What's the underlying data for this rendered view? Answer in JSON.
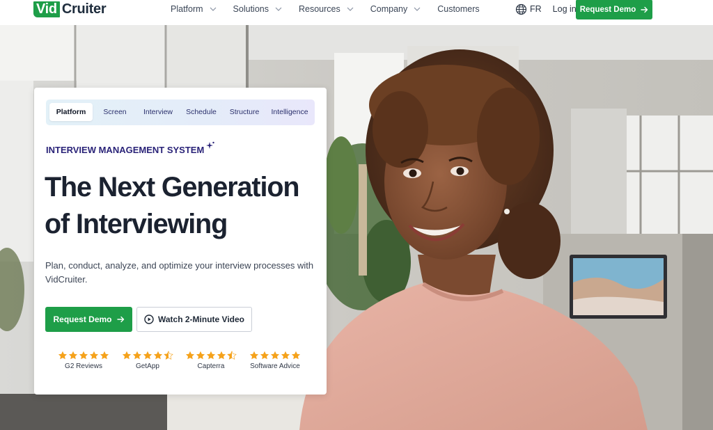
{
  "header": {
    "logo_box": "Vid",
    "logo_rest": "Cruiter",
    "nav": [
      {
        "label": "Platform",
        "has_dropdown": true
      },
      {
        "label": "Solutions",
        "has_dropdown": true
      },
      {
        "label": "Resources",
        "has_dropdown": true
      },
      {
        "label": "Company",
        "has_dropdown": true
      },
      {
        "label": "Customers",
        "has_dropdown": false
      }
    ],
    "language": "FR",
    "login": "Log in",
    "request_demo": "Request Demo"
  },
  "card": {
    "tabs": [
      {
        "label": "Platform",
        "active": true
      },
      {
        "label": "Screen",
        "active": false
      },
      {
        "label": "Interview",
        "active": false
      },
      {
        "label": "Schedule",
        "active": false
      },
      {
        "label": "Structure",
        "active": false
      },
      {
        "label": "Intelligence",
        "active": false
      }
    ],
    "eyebrow": "INTERVIEW MANAGEMENT SYSTEM",
    "headline_line1": "The Next Generation",
    "headline_line2": "of Interviewing",
    "subtext": "Plan, conduct, analyze, and optimize your interview processes with VidCruiter.",
    "primary_cta": "Request Demo",
    "secondary_cta": "Watch 2-Minute Video",
    "ratings": [
      {
        "label": "G2 Reviews",
        "stars": 5
      },
      {
        "label": "GetApp",
        "stars": 4.5
      },
      {
        "label": "Capterra",
        "stars": 4.5
      },
      {
        "label": "Software Advice",
        "stars": 5
      }
    ]
  },
  "colors": {
    "brand_green": "#1e9e48",
    "eyebrow_navy": "#2a2378",
    "star_orange": "#f5a21b",
    "headline": "#1b2230"
  },
  "icons": [
    "chevron-down-icon",
    "globe-icon",
    "arrow-right-icon",
    "sparkle-icon",
    "play-circle-icon",
    "star-icon"
  ]
}
